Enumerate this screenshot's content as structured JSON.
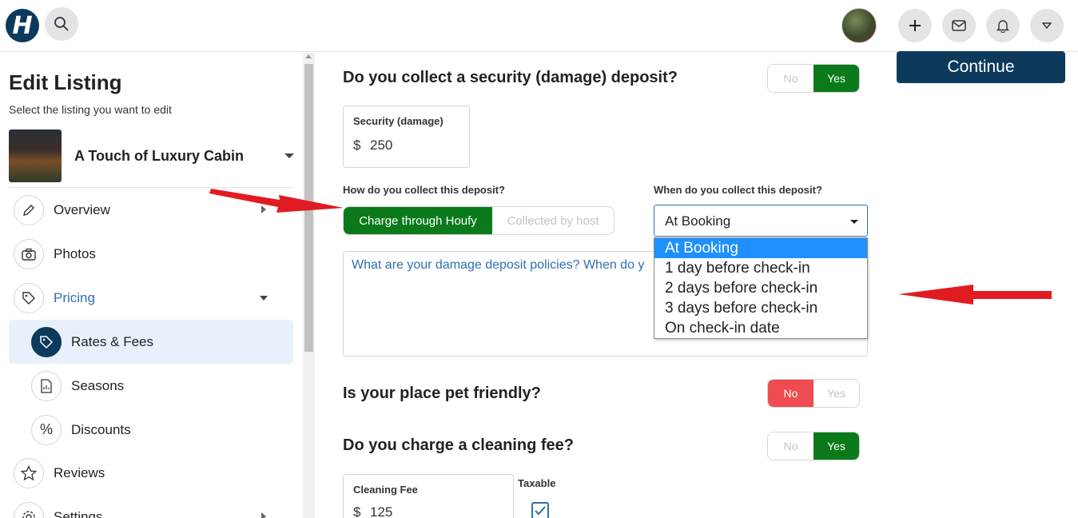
{
  "header": {
    "logo_letter": "H",
    "icons": [
      "search-icon",
      "plus-icon",
      "mail-icon",
      "bell-icon",
      "chevron-down-icon"
    ]
  },
  "continue_label": "Continue",
  "sidebar": {
    "title": "Edit Listing",
    "subtitle": "Select the listing you want to edit",
    "listing_name": "A Touch of Luxury Cabin",
    "items": [
      {
        "label": "Overview",
        "icon": "pencil-icon"
      },
      {
        "label": "Photos",
        "icon": "camera-icon"
      },
      {
        "label": "Pricing",
        "icon": "tag-icon"
      },
      {
        "label": "Rates & Fees",
        "icon": "tag-icon"
      },
      {
        "label": "Seasons",
        "icon": "document-icon"
      },
      {
        "label": "Discounts",
        "icon": "percent-icon"
      },
      {
        "label": "Reviews",
        "icon": "star-icon"
      },
      {
        "label": "Settings",
        "icon": "gear-icon"
      }
    ]
  },
  "deposit": {
    "question": "Do you collect a security (damage) deposit?",
    "toggle": {
      "no": "No",
      "yes": "Yes",
      "selected": "Yes"
    },
    "field_label": "Security (damage)",
    "currency": "$",
    "amount": "250",
    "how_label": "How do you collect this deposit?",
    "how_options": [
      "Charge through Houfy",
      "Collected by host"
    ],
    "how_selected": "Charge through Houfy",
    "when_label": "When do you collect this deposit?",
    "when_value": "At Booking",
    "when_options": [
      "At Booking",
      "1 day before check-in",
      "2 days before check-in",
      "3 days before check-in",
      "On check-in date"
    ],
    "policy_placeholder": "What are your damage deposit policies? When do y"
  },
  "pets": {
    "question": "Is your place pet friendly?",
    "toggle": {
      "no": "No",
      "yes": "Yes",
      "selected": "No"
    }
  },
  "cleaning": {
    "question": "Do you charge a cleaning fee?",
    "toggle": {
      "no": "No",
      "yes": "Yes",
      "selected": "Yes"
    },
    "field_label": "Cleaning Fee",
    "currency": "$",
    "amount": "125",
    "taxable_label": "Taxable",
    "taxable_checked": true
  },
  "colors": {
    "brand_navy": "#0d3a5c",
    "green": "#0b7a1a",
    "red": "#ef4b50",
    "link_blue": "#2f6fb1",
    "highlight_blue": "#1e90ff",
    "annotation_red": "#e11b22"
  }
}
